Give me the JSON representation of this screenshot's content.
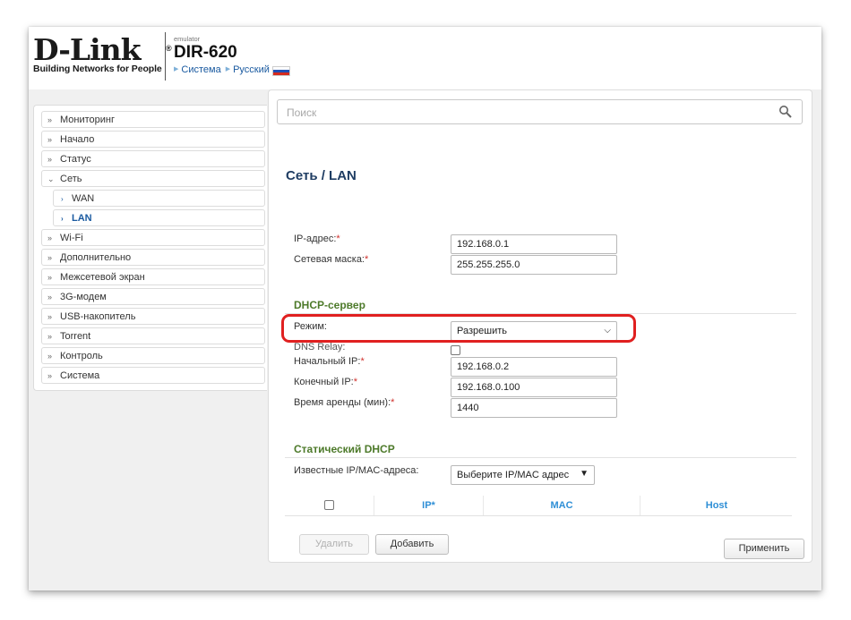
{
  "brand": {
    "logo_text": "D-Link",
    "reg_mark": "®",
    "tagline": "Building Networks for People",
    "emulator_label": "emulator",
    "model": "DIR-620",
    "crumb_system": "Система",
    "crumb_language": "Русский"
  },
  "sidebar": {
    "items": [
      {
        "label": "Мониторинг",
        "icon": "chevron-right-circle-icon"
      },
      {
        "label": "Начало",
        "icon": "chevron-right-circle-icon"
      },
      {
        "label": "Статус",
        "icon": "chevron-right-circle-icon"
      },
      {
        "label": "Сеть",
        "icon": "chevron-down-circle-icon"
      },
      {
        "label": "WAN",
        "icon": "caret-right-icon"
      },
      {
        "label": "LAN",
        "icon": "caret-right-icon"
      },
      {
        "label": "Wi-Fi",
        "icon": "chevron-right-circle-icon"
      },
      {
        "label": "Дополнительно",
        "icon": "chevron-right-circle-icon"
      },
      {
        "label": "Межсетевой экран",
        "icon": "chevron-right-circle-icon"
      },
      {
        "label": "3G-модем",
        "icon": "chevron-right-circle-icon"
      },
      {
        "label": "USB-накопитель",
        "icon": "chevron-right-circle-icon"
      },
      {
        "label": "Torrent",
        "icon": "chevron-right-circle-icon"
      },
      {
        "label": "Контроль",
        "icon": "chevron-right-circle-icon"
      },
      {
        "label": "Система",
        "icon": "chevron-right-circle-icon"
      }
    ]
  },
  "search": {
    "placeholder": "Поиск"
  },
  "page": {
    "title": "Сеть /  LAN"
  },
  "lan": {
    "ip_label": "IP-адрес:",
    "ip_value": "192.168.0.1",
    "mask_label": "Сетевая маска:",
    "mask_value": "255.255.255.0"
  },
  "dhcp": {
    "section_title": "DHCP-сервер",
    "mode_label": "Режим:",
    "mode_value": "Разрешить",
    "dns_relay_label": "DNS Relay:",
    "dns_relay_checked": false,
    "start_ip_label": "Начальный IP:",
    "start_ip_value": "192.168.0.2",
    "end_ip_label": "Конечный IP:",
    "end_ip_value": "192.168.0.100",
    "lease_label": "Время аренды (мин):",
    "lease_value": "1440"
  },
  "static_dhcp": {
    "section_title": "Статический DHCP",
    "known_label": "Известные IP/MAC-адреса:",
    "known_select": "Выберите IP/MAC адрес",
    "columns": [
      "IP*",
      "MAC",
      "Host"
    ]
  },
  "buttons": {
    "delete": "Удалить",
    "add": "Добавить",
    "apply": "Применить"
  },
  "required_mark": "*",
  "colors": {
    "accent_blue": "#1a5aa0",
    "section_green": "#4d7a2a",
    "highlight_red": "#e02020",
    "table_header_blue": "#2f8fd6"
  }
}
